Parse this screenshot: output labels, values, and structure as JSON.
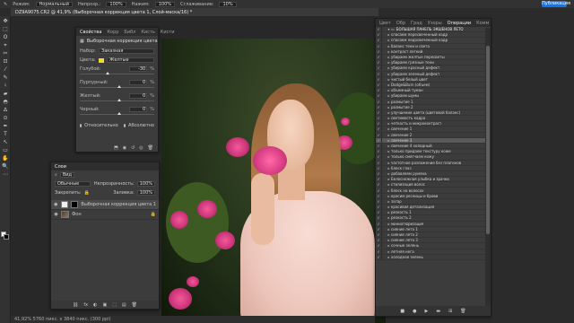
{
  "app": {
    "share_label": "Публикация",
    "doc_tab": "DZ9A9075.CR2 @ 41,9% (Выборочная коррекция цвета 1, Слой-маска/16) *",
    "status": "41,92%   5760 пикс. x 3840 пикс. (300 ppi)"
  },
  "optbar": {
    "mode_label": "Режим:",
    "mode_value": "Нормальный",
    "opacity_label": "Непрозр.:",
    "opacity_value": "100%",
    "flow_label": "Нажим:",
    "flow_value": "100%",
    "smooth_label": "Сглаживание:",
    "smooth_value": "10%"
  },
  "toolbar": {
    "tools": [
      "✥",
      "⬚",
      "ʘ",
      "⌖",
      "✂",
      "⊡",
      "⁄",
      "✎",
      "♮",
      "▰",
      "◓",
      "∆",
      "⊙",
      "✒",
      "T",
      "↖",
      "▭",
      "✋",
      "🔍",
      "⋯"
    ]
  },
  "colors": {
    "accent": "#1473e6",
    "swatch_yellow": "#f1d82a",
    "foreground": "#ffffff",
    "background": "#000000"
  },
  "properties": {
    "tabs": [
      "Свойства",
      "Корр",
      "Библ",
      "Кисть",
      "Кисти"
    ],
    "header": "Выборочная коррекция цвета",
    "preset_label": "Набор:",
    "preset_value": "Заказная",
    "colors_label": "Цвета:",
    "colors_value": "Желтые",
    "sliders": [
      {
        "label": "Голубой:",
        "value": "-30",
        "pct": "%",
        "level": 0.35
      },
      {
        "label": "Пурпурный:",
        "value": "0",
        "pct": "%",
        "level": 0.5
      },
      {
        "label": "Желтый:",
        "value": "0",
        "pct": "%",
        "level": 0.5
      },
      {
        "label": "Черный:",
        "value": "0",
        "pct": "%",
        "level": 0.5
      }
    ],
    "relative": "Относительно",
    "absolute": "Абсолютно"
  },
  "layers": {
    "tabs": [
      "Слои"
    ],
    "kind_label": "Вид",
    "blend_value": "Обычные",
    "opacity_label": "Непрозрачность:",
    "opacity_value": "100%",
    "lock_label": "Закрепить:",
    "fill_label": "Заливка:",
    "fill_value": "100%",
    "items": [
      {
        "name": "Выборочная коррекция цвета 1",
        "selected": true,
        "type": "adj"
      },
      {
        "name": "Фон",
        "selected": false,
        "type": "photo"
      }
    ],
    "footer_icons": [
      "fx",
      "◐",
      "▣",
      "⬚",
      "▤",
      "🗑"
    ]
  },
  "actions": {
    "tabs": [
      "Цвет",
      "Обр",
      "Град",
      "Узоры",
      "Операции",
      "Комм",
      "Ист"
    ],
    "items": [
      {
        "name": "БОЛЬШАЯ ПАНЕЛЬ ЭКШЕНОВ ЛЕТО",
        "group": true,
        "selected": false
      },
      {
        "name": "спасаем пересвеченный кадр",
        "group": false,
        "selected": false
      },
      {
        "name": "спасаем недосвеченный кадр",
        "group": false,
        "selected": false
      },
      {
        "name": "баланс тени и света",
        "group": false,
        "selected": false
      },
      {
        "name": "контраст легкий",
        "group": false,
        "selected": false
      },
      {
        "name": "убираем желтые пересветы",
        "group": false,
        "selected": false
      },
      {
        "name": "убираем грязные тени",
        "group": false,
        "selected": false
      },
      {
        "name": "убираем красный дефект",
        "group": false,
        "selected": false
      },
      {
        "name": "убираем зеленый дефект",
        "group": false,
        "selected": false
      },
      {
        "name": "чистый белый цвет",
        "group": false,
        "selected": false
      },
      {
        "name": "Dodge&Burn (объем)",
        "group": false,
        "selected": false
      },
      {
        "name": "объемный туман",
        "group": false,
        "selected": false
      },
      {
        "name": "убираем шумы",
        "group": false,
        "selected": false
      },
      {
        "name": "размытие 1",
        "group": false,
        "selected": false
      },
      {
        "name": "размытие 2",
        "group": false,
        "selected": false
      },
      {
        "name": "улучшение цвета (цветовой баланс)",
        "group": false,
        "selected": false
      },
      {
        "name": "светимость кадра",
        "group": false,
        "selected": false
      },
      {
        "name": "четкость и микроконтраст",
        "group": false,
        "selected": false
      },
      {
        "name": "свечение 1",
        "group": false,
        "selected": false
      },
      {
        "name": "свечение 2",
        "group": false,
        "selected": false
      },
      {
        "name": "свечение 3",
        "group": false,
        "selected": true
      },
      {
        "name": "свечение 4 холодный",
        "group": false,
        "selected": false
      },
      {
        "name": "только придаем текстуру коже",
        "group": false,
        "selected": false
      },
      {
        "name": "только смягчаем кожу",
        "group": false,
        "selected": false
      },
      {
        "name": "частотное разложение без плагинов",
        "group": false,
        "selected": false
      },
      {
        "name": "блеск глаз",
        "group": false,
        "selected": false
      },
      {
        "name": "добавляем румяна",
        "group": false,
        "selected": false
      },
      {
        "name": "Белоснежная улыбка и зрачки",
        "group": false,
        "selected": false
      },
      {
        "name": "стилизация волос",
        "group": false,
        "selected": false
      },
      {
        "name": "блеск на волосах",
        "group": false,
        "selected": false
      },
      {
        "name": "красим ресницы и брови",
        "group": false,
        "selected": false
      },
      {
        "name": "загар",
        "group": false,
        "selected": false
      },
      {
        "name": "красивая детализация",
        "group": false,
        "selected": false
      },
      {
        "name": "резкость 1",
        "group": false,
        "selected": false
      },
      {
        "name": "резкость 2",
        "group": false,
        "selected": false
      },
      {
        "name": "миниатюризация",
        "group": false,
        "selected": false
      },
      {
        "name": "сияние лета 1",
        "group": false,
        "selected": false
      },
      {
        "name": "сияние лета 2",
        "group": false,
        "selected": false
      },
      {
        "name": "сияние лета 3",
        "group": false,
        "selected": false
      },
      {
        "name": "сочные зелень",
        "group": false,
        "selected": false
      },
      {
        "name": "летняя нега",
        "group": false,
        "selected": false
      },
      {
        "name": "холодная зелень",
        "group": false,
        "selected": false
      }
    ],
    "footer_icons": [
      "■",
      "●",
      "▶",
      "▬",
      "⊞",
      "🗑"
    ]
  }
}
